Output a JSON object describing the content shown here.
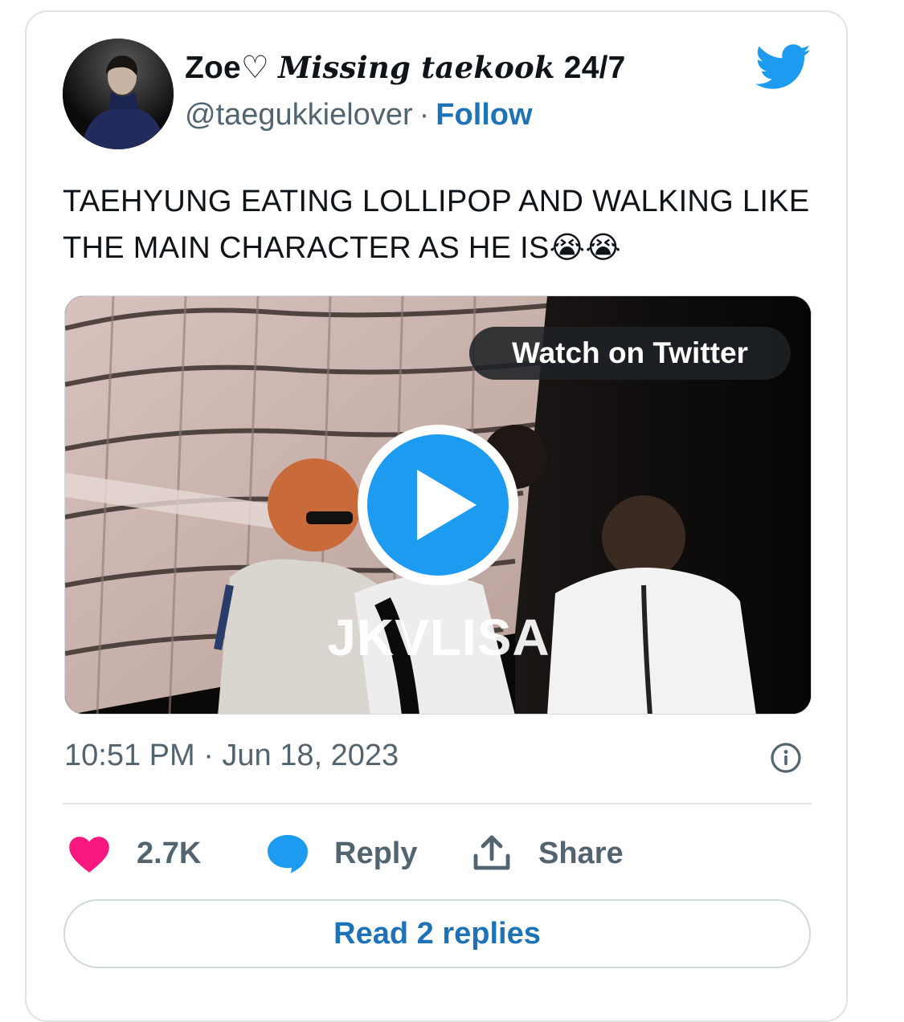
{
  "author": {
    "name_prefix": "Zoe♡ ",
    "name_script": "Missing taekook",
    "name_suffix": " 24/7",
    "handle": "@taegukkielover",
    "separator": "·",
    "follow_label": "Follow"
  },
  "tweet": {
    "text": "TAEHYUNG EATING LOLLIPOP AND WALKING LIKE THE MAIN CHARACTER AS HE IS😭😭"
  },
  "media": {
    "watch_label": "Watch on Twitter",
    "watermark": "JKVLISA"
  },
  "meta": {
    "timestamp": "10:51 PM · Jun 18, 2023"
  },
  "actions": {
    "like_count": "2.7K",
    "reply_label": "Reply",
    "share_label": "Share"
  },
  "footer": {
    "read_replies_label": "Read 2 replies"
  },
  "icons": {
    "brand": "twitter-bird-icon",
    "like": "heart-icon",
    "reply": "speech-bubble-icon",
    "share": "upload-icon",
    "info": "info-icon",
    "play": "play-icon"
  },
  "colors": {
    "brand_blue": "#1d9bf0",
    "link_blue": "#1d72b8",
    "heart_pink": "#f91880",
    "muted_text": "#536471",
    "primary_text": "#0f1419"
  }
}
